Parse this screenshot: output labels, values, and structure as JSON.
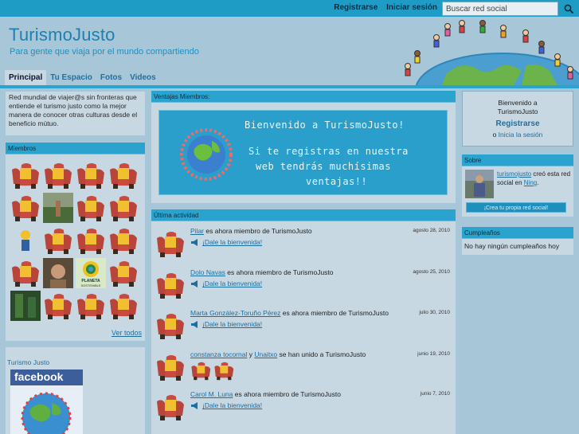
{
  "topbar": {
    "register": "Registrarse",
    "login": "Iniciar sesión",
    "search_placeholder": "Buscar red social"
  },
  "header": {
    "title": "TurismoJusto",
    "subtitle": "Para gente que viaja por el mundo compartiendo"
  },
  "tabs": [
    "Principal",
    "Tu Espacio",
    "Fotos",
    "Videos"
  ],
  "intro": "Red mundial de viajer@s sin fronteras que entiende el turismo justo como la mejor manera de conocer otras culturas desde el beneficio mútuo.",
  "members": {
    "title": "Miembros",
    "see_all": "Ver todos",
    "logo_text": "PLANETA SOSTENIBLE"
  },
  "turismo": {
    "title": "Turismo Justo",
    "fb_label": "facebook"
  },
  "ventajas": {
    "title": "Ventajas Miembros:",
    "line1": "Bienvenido a TurismoJusto!",
    "line2": "Si te registras en nuestra",
    "line3": "web tendrás muchísimas",
    "line4": "ventajas!!"
  },
  "activity": {
    "title": "Última actividad",
    "welcome_label": "¡Dale la bienvenida!",
    "items": [
      {
        "user": "Pilar",
        "text": " es ahora miembro de TurismoJusto",
        "date": "agosto 28, 2010"
      },
      {
        "user": "Dolo Navas",
        "text": " es ahora miembro de TurismoJusto",
        "date": "agosto 25, 2010"
      },
      {
        "user": "Marta González-Toruño Pérez",
        "text": " es ahora miembro de TurismoJusto",
        "date": "julio 30, 2010"
      },
      {
        "user": "constanza tocornal",
        "and": " y ",
        "user2": "Unaitxo",
        "text": " se han unido a TurismoJusto",
        "date": "junio 19, 2010"
      },
      {
        "user": "Carol M. Luna",
        "text": " es ahora miembro de TurismoJusto",
        "date": "junio 7, 2010"
      }
    ]
  },
  "welcome_box": {
    "line1": "Bienvenido a",
    "line2": "TurismoJusto",
    "register": "Registrarse",
    "or": "o ",
    "login": "Inicia la sesión"
  },
  "sobre": {
    "title": "Sobre",
    "user": "turismojusto",
    "text": " creó esta red social en ",
    "link": "Ning",
    "end": ".",
    "button": "¡Crea tu propia red social!"
  },
  "cumple": {
    "title": "Cumpleaños",
    "none": "No hay ningún cumpleaños hoy"
  },
  "colors": {
    "accent": "#2aa4cf",
    "link": "#1a6fa0",
    "panel": "#c8d8e2",
    "page": "#a7c7d8"
  }
}
